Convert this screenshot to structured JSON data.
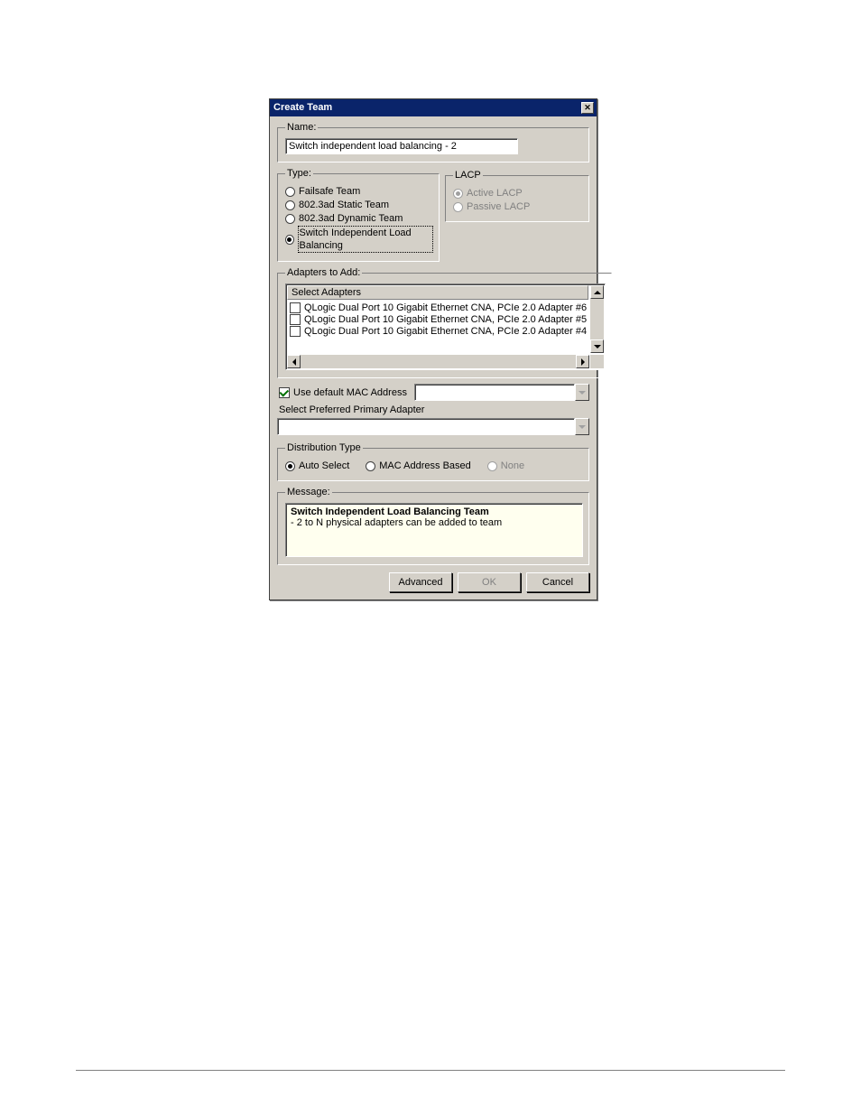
{
  "titlebar": {
    "title": "Create Team"
  },
  "name": {
    "legend": "Name:",
    "value": "Switch independent load balancing - 2"
  },
  "type": {
    "legend": "Type:",
    "options": {
      "failsafe": "Failsafe Team",
      "static": "802.3ad Static Team",
      "dynamic": "802.3ad Dynamic Team",
      "silb": "Switch Independent Load Balancing"
    }
  },
  "lacp": {
    "legend": "LACP",
    "active": "Active LACP",
    "passive": "Passive LACP"
  },
  "adapters": {
    "legend": "Adapters to Add:",
    "header": "Select Adapters",
    "items": [
      "QLogic Dual Port 10 Gigabit Ethernet CNA, PCIe 2.0 Adapter #6",
      "QLogic Dual Port 10 Gigabit Ethernet CNA, PCIe 2.0 Adapter #5",
      "QLogic Dual Port 10 Gigabit Ethernet CNA, PCIe 2.0 Adapter #4"
    ]
  },
  "mac": {
    "use_default_label": "Use default MAC Address",
    "value": ""
  },
  "preferred": {
    "label": "Select Preferred Primary Adapter",
    "value": ""
  },
  "dist": {
    "legend": "Distribution Type",
    "auto": "Auto Select",
    "mac": "MAC Address Based",
    "none": "None"
  },
  "message": {
    "legend": "Message:",
    "title": "Switch Independent Load Balancing Team",
    "body": "- 2 to N physical adapters can be added to team"
  },
  "buttons": {
    "advanced": "Advanced",
    "ok": "OK",
    "cancel": "Cancel"
  }
}
